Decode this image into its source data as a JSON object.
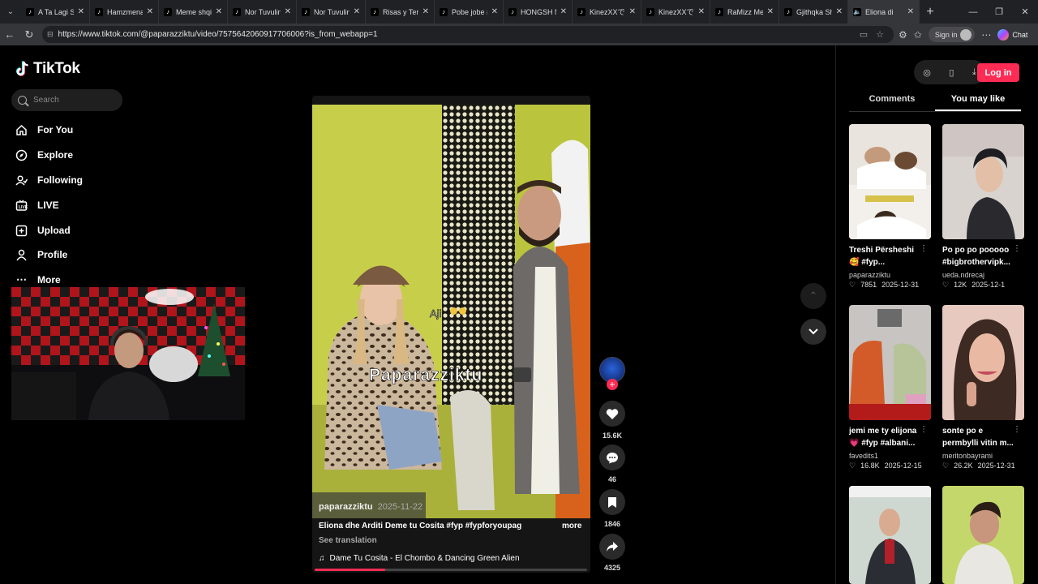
{
  "browser": {
    "tabs": [
      {
        "title": "A Ta Lagi Shq"
      },
      {
        "title": "Hamzmenagj"
      },
      {
        "title": "Meme shqip:"
      },
      {
        "title": "Nor Tuvulin:"
      },
      {
        "title": "Nor Tuvulin:"
      },
      {
        "title": "Risas y Terro"
      },
      {
        "title": "Pobe jobe #"
      },
      {
        "title": "HONGSH MI"
      },
      {
        "title": "KinezXXで笑"
      },
      {
        "title": "KinezXXで笑"
      },
      {
        "title": "RaMizz Ment"
      },
      {
        "title": "Gjithqka Shq"
      },
      {
        "title": "Eliona di"
      }
    ],
    "url": "https://www.tiktok.com/@paparazziktu/video/7575642060917706006?is_from_webapp=1",
    "signin_label": "Sign in",
    "chat_label": "Chat"
  },
  "sidebar": {
    "logo_text": "TikTok",
    "search_placeholder": "Search",
    "items": [
      {
        "label": "For You",
        "icon": "home-icon"
      },
      {
        "label": "Explore",
        "icon": "compass-icon"
      },
      {
        "label": "Following",
        "icon": "following-icon"
      },
      {
        "label": "LIVE",
        "icon": "live-icon"
      },
      {
        "label": "Upload",
        "icon": "upload-icon"
      },
      {
        "label": "Profile",
        "icon": "profile-icon"
      },
      {
        "label": "More",
        "icon": "more-icon"
      }
    ]
  },
  "video": {
    "overlay_text_small": "Aji",
    "overlay_watermark": "Paparazziktu",
    "author": "paparazziktu",
    "date": "2025-11-22",
    "description": "Eliona dhe Arditi Deme tu Cosita #fyp #fypforyoupage ...",
    "more_label": "more",
    "translate_label": "See translation",
    "music": "Dame Tu Cosita - El Chombo & Dancing Green Alien",
    "progress": 0.26
  },
  "actions": {
    "likes": "15.6K",
    "comments": "46",
    "saves": "1846",
    "shares": "4325"
  },
  "right_panel": {
    "login_label": "Log in",
    "tabs": [
      {
        "label": "Comments",
        "active": false
      },
      {
        "label": "You may like",
        "active": true
      }
    ],
    "cards": [
      {
        "title": "Treshi Përsheshi 🥰 #fyp...",
        "author": "paparazziktu",
        "likes": "7851",
        "date": "2025-12-31"
      },
      {
        "title": "Po po po pooooo #bigbrothervipk...",
        "author": "ueda.ndrecaj",
        "likes": "12K",
        "date": "2025-12-1"
      },
      {
        "title": "jemi me ty elijona 💗 #fyp #albani...",
        "author": "favedits1",
        "likes": "16.8K",
        "date": "2025-12-15"
      },
      {
        "title": "sonte po e permbylli vitin m...",
        "author": "meritonbayrami",
        "likes": "26.2K",
        "date": "2025-12-31"
      },
      {
        "title": "",
        "author": "",
        "likes": "",
        "date": ""
      },
      {
        "title": "",
        "author": "",
        "likes": "",
        "date": ""
      }
    ]
  },
  "colors": {
    "accent": "#fe2c55",
    "background": "#000000"
  }
}
